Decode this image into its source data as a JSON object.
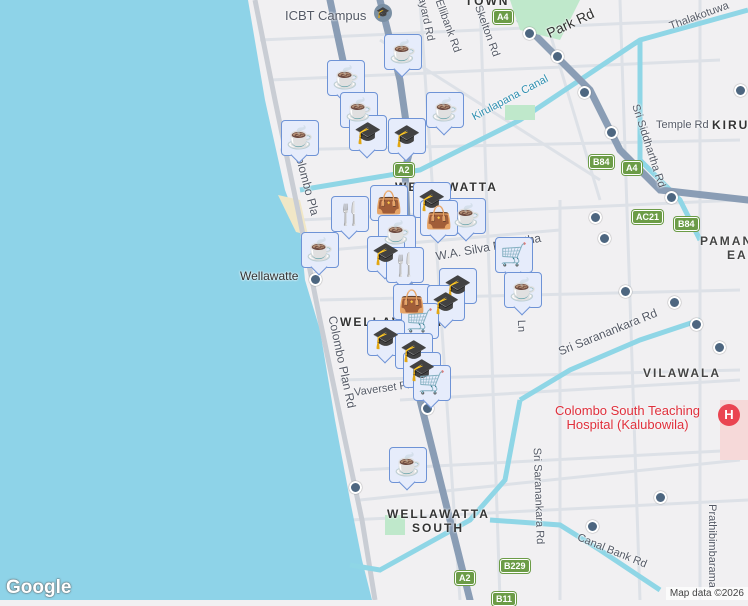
{
  "map": {
    "places": {
      "icbt": "ICBT Campus",
      "hospital_line1": "Colombo South Teaching",
      "hospital_line2": "Hospital (Kalubowila)",
      "hospital_icon": "H",
      "wellawatte_station": "Wellawatte"
    },
    "areas": [
      "WELLAWATTA",
      "WELLAWATTA",
      "SOUTH",
      "VILAWALA",
      "PAMAN",
      "EAS",
      "KIRU",
      "TOWN"
    ],
    "roads": [
      "Layard Rd",
      "Ellibank Rd",
      "Skelton Rd",
      "Park Rd",
      "Thalakotuwa",
      "Kirulapana Canal",
      "Temple Rd",
      "Sri Siddhartha Rd",
      "Colombo Plan Rd",
      "Colombo Pla",
      "W.A. Silva Mawatha",
      "Sri Saranankara Rd",
      "Sri Saranankara Rd",
      "Vaverset Pl",
      "Canal Bank Rd",
      "Prathibimbarama",
      "Ln"
    ],
    "shields": [
      "A4",
      "A4",
      "A2",
      "A2",
      "B84",
      "B84",
      "AC21",
      "B229",
      "B11"
    ],
    "attribution": "Map data ©2026",
    "logo": "Google"
  },
  "marker_glyphs": {
    "cafe": "☕",
    "education": "🎓",
    "shop": "👜",
    "restaurant": "🍴",
    "cart": "🛒"
  },
  "colors": {
    "water": "#8ed3e8",
    "canal": "#8fd6e6",
    "highway": "#8a9db5",
    "marker_bg": "#e6ecfb",
    "marker_border": "#6e93d6",
    "icon": "#0e4368"
  }
}
